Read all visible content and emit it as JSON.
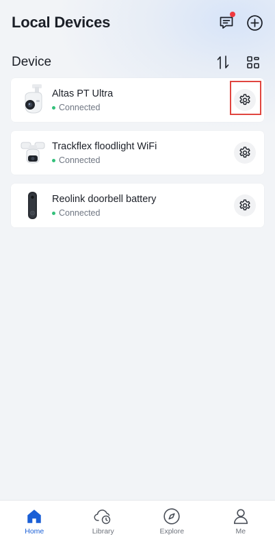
{
  "header": {
    "title": "Local Devices",
    "messages_icon": "chat-bubble-icon",
    "has_unread": true,
    "add_icon": "plus-circle-icon"
  },
  "section": {
    "title": "Device",
    "sort_icon": "sort-arrows-icon",
    "layout_icon": "grid-layout-icon"
  },
  "devices": [
    {
      "name": "Altas PT Ultra",
      "status": "Connected",
      "thumb_icon": "pt-camera-icon"
    },
    {
      "name": "Trackflex floodlight WiFi",
      "status": "Connected",
      "thumb_icon": "floodlight-camera-icon"
    },
    {
      "name": "Reolink doorbell battery",
      "status": "Connected",
      "thumb_icon": "doorbell-icon"
    }
  ],
  "colors": {
    "accent": "#1a5fd6",
    "status_online": "#33c07a",
    "badge": "#f0393f",
    "highlight": "#e0453f"
  },
  "tabbar": {
    "tabs": [
      {
        "label": "Home",
        "icon": "home-icon",
        "active": true
      },
      {
        "label": "Library",
        "icon": "cloud-clock-icon",
        "active": false
      },
      {
        "label": "Explore",
        "icon": "compass-icon",
        "active": false
      },
      {
        "label": "Me",
        "icon": "user-icon",
        "active": false
      }
    ]
  }
}
